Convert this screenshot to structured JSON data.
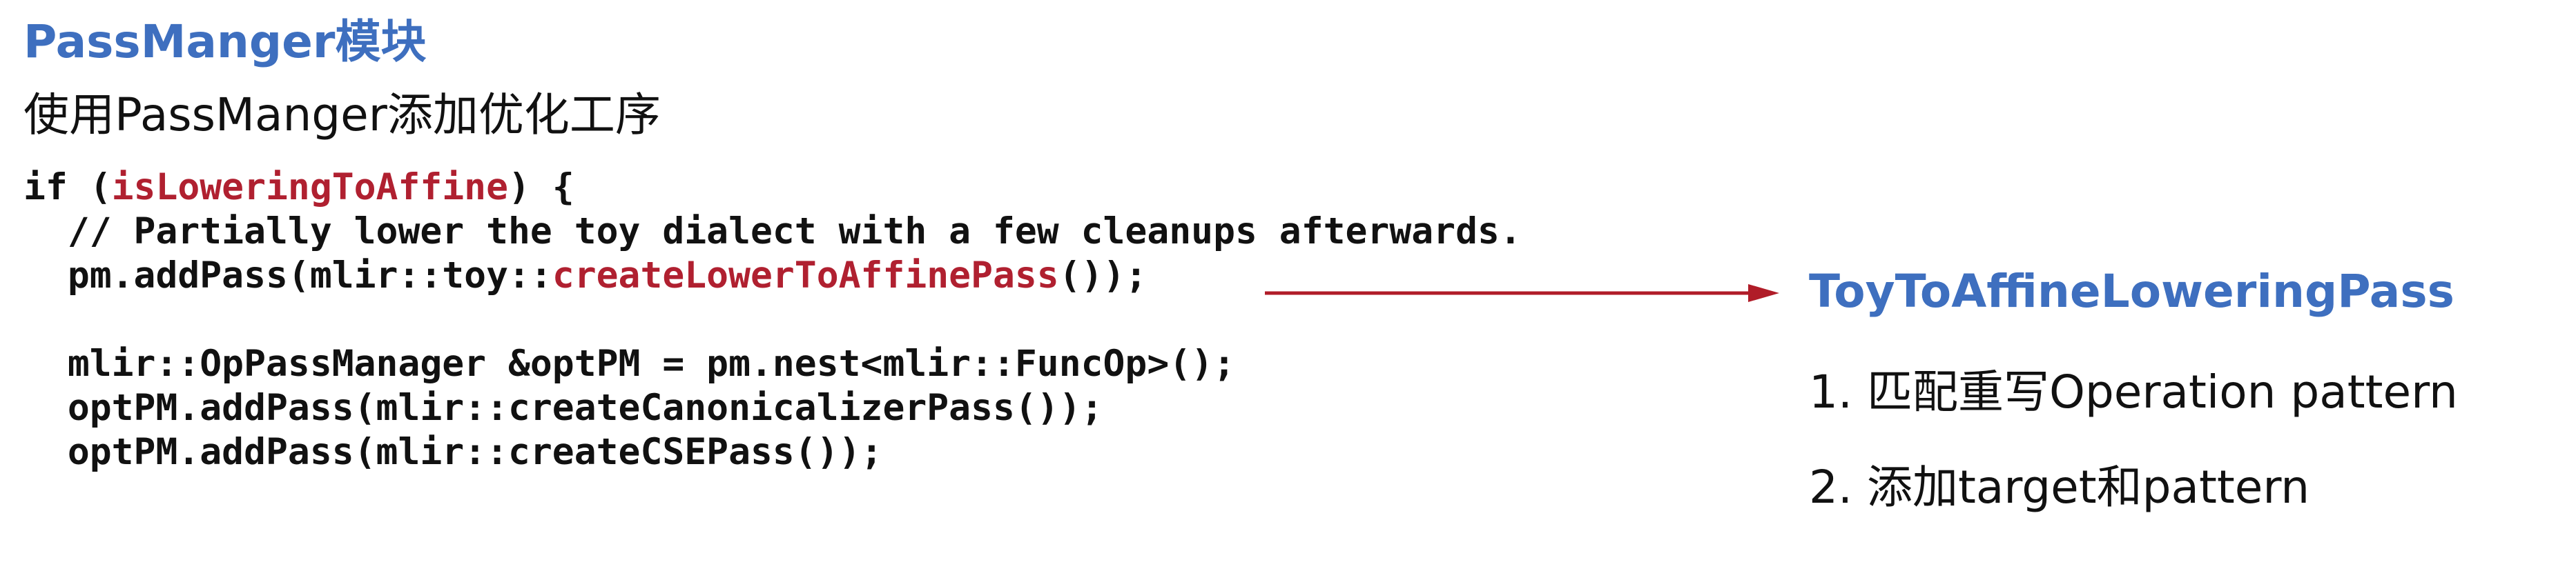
{
  "slide": {
    "title": "PassManger模块",
    "subtitle": "使用PassManger添加优化工序",
    "code": {
      "line1_pre": "if (",
      "line1_hl": "isLoweringToAffine",
      "line1_post": ") {",
      "line2": "  // Partially lower the toy dialect with a few cleanups afterwards.",
      "line3_pre": "  pm.addPass(mlir::toy::",
      "line3_hl": "createLowerToAffinePass",
      "line3_post": "());",
      "line4": "",
      "line5": "  mlir::OpPassManager &optPM = pm.nest<mlir::FuncOp>();",
      "line6": "  optPM.addPass(mlir::createCanonicalizerPass());",
      "line7": "  optPM.addPass(mlir::createCSEPass());"
    },
    "side": {
      "title": "ToyToAffineLoweringPass",
      "items": [
        "1. 匹配重写Operation pattern",
        "2. 添加target和pattern"
      ]
    },
    "colors": {
      "accent_blue": "#3e6fbf",
      "highlight_red": "#b02030",
      "arrow_red": "#b01c28"
    }
  }
}
